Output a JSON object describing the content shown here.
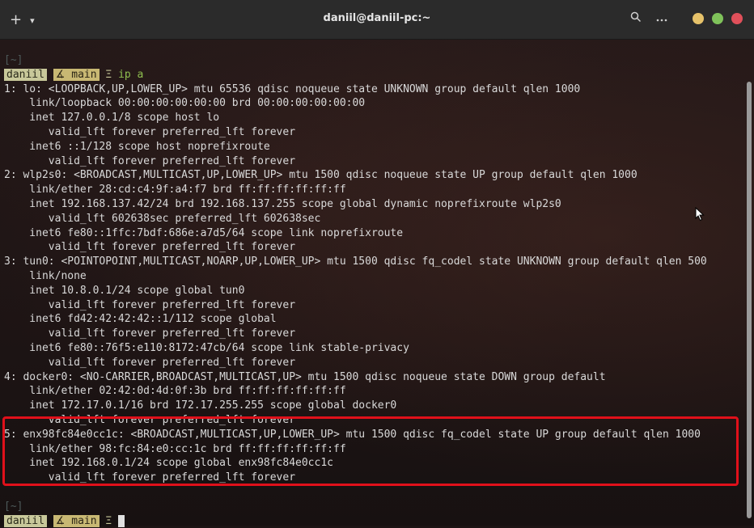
{
  "titlebar": {
    "title": "daniil@daniil-pc:~",
    "new_tab": "+",
    "menu_chevron": "▾",
    "search_icon": "search-icon",
    "more_icon": "more-icon",
    "colors": {
      "minimize": "#e6c26a",
      "maximize": "#7fc25a",
      "close": "#e0505a"
    }
  },
  "terminal": {
    "lines": [
      "[~]",
      null,
      "1: lo: <LOOPBACK,UP,LOWER_UP> mtu 65536 qdisc noqueue state UNKNOWN group default qlen 1000",
      "    link/loopback 00:00:00:00:00:00 brd 00:00:00:00:00:00",
      "    inet 127.0.0.1/8 scope host lo",
      "       valid_lft forever preferred_lft forever",
      "    inet6 ::1/128 scope host noprefixroute",
      "       valid_lft forever preferred_lft forever",
      "2: wlp2s0: <BROADCAST,MULTICAST,UP,LOWER_UP> mtu 1500 qdisc noqueue state UP group default qlen 1000",
      "    link/ether 28:cd:c4:9f:a4:f7 brd ff:ff:ff:ff:ff:ff",
      "    inet 192.168.137.42/24 brd 192.168.137.255 scope global dynamic noprefixroute wlp2s0",
      "       valid_lft 602638sec preferred_lft 602638sec",
      "    inet6 fe80::1ffc:7bdf:686e:a7d5/64 scope link noprefixroute",
      "       valid_lft forever preferred_lft forever",
      "3: tun0: <POINTOPOINT,MULTICAST,NOARP,UP,LOWER_UP> mtu 1500 qdisc fq_codel state UNKNOWN group default qlen 500",
      "    link/none",
      "    inet 10.8.0.1/24 scope global tun0",
      "       valid_lft forever preferred_lft forever",
      "    inet6 fd42:42:42:42::1/112 scope global",
      "       valid_lft forever preferred_lft forever",
      "    inet6 fe80::76f5:e110:8172:47cb/64 scope link stable-privacy",
      "       valid_lft forever preferred_lft forever",
      "4: docker0: <NO-CARRIER,BROADCAST,MULTICAST,UP> mtu 1500 qdisc noqueue state DOWN group default",
      "    link/ether 02:42:0d:4d:0f:3b brd ff:ff:ff:ff:ff:ff",
      "    inet 172.17.0.1/16 brd 172.17.255.255 scope global docker0",
      "       valid_lft forever preferred_lft forever",
      "5: enx98fc84e0cc1c: <BROADCAST,MULTICAST,UP,LOWER_UP> mtu 1500 qdisc fq_codel state UP group default qlen 1000",
      "    link/ether 98:fc:84:e0:cc:1c brd ff:ff:ff:ff:ff:ff",
      "    inet 192.168.0.1/24 scope global enx98fc84e0cc1c",
      "       valid_lft forever preferred_lft forever",
      "",
      "[~]"
    ],
    "prompt": {
      "user": "daniil",
      "branch_icon": "⸙",
      "branch_glyph": "∡",
      "branch": "main",
      "sep": "Ξ",
      "command": "ip a"
    },
    "highlight_color": "#e0101a"
  }
}
